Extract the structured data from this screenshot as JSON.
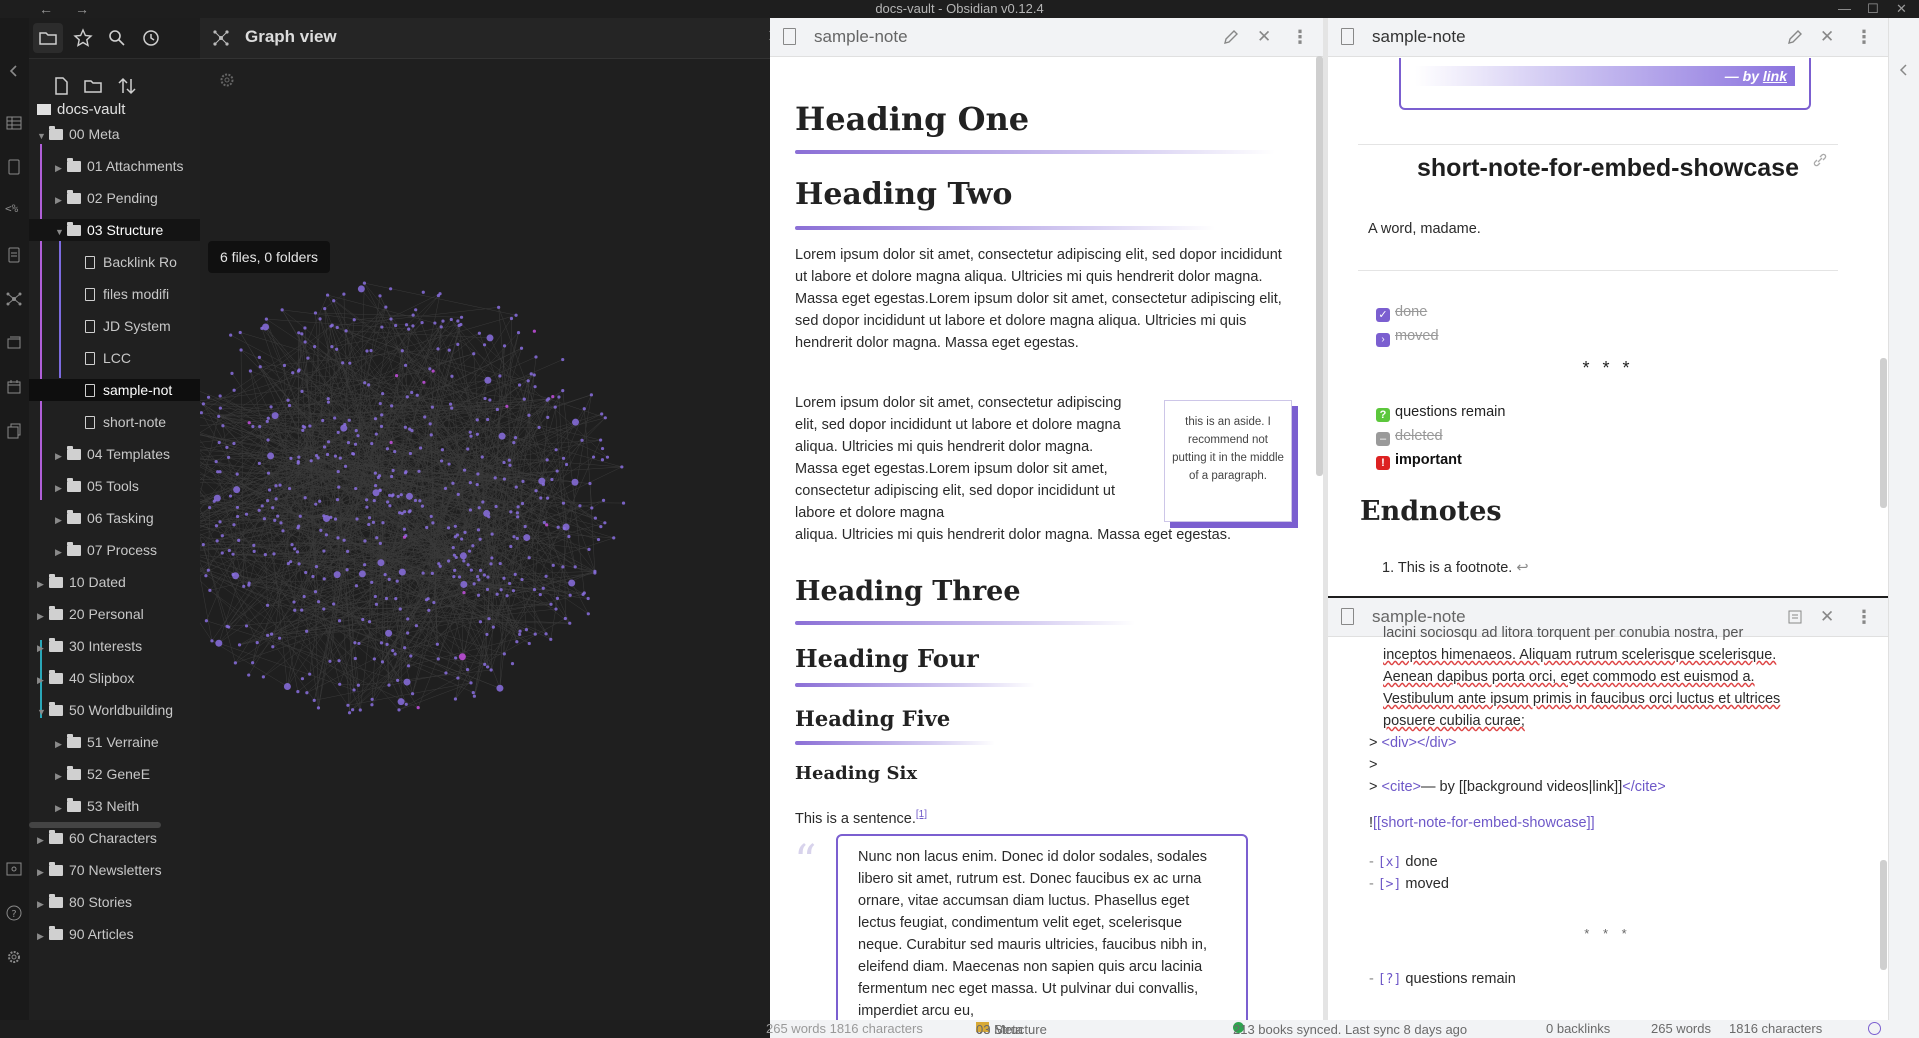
{
  "window": {
    "title": "docs-vault - Obsidian v0.12.4"
  },
  "left_sidebar": {
    "vault_name": "docs-vault",
    "tooltip": "6 files, 0 folders",
    "tree": [
      {
        "label": "00 Meta",
        "type": "folder",
        "open": true,
        "depth": 0
      },
      {
        "label": "01 Attachments",
        "type": "folder",
        "open": false,
        "depth": 1
      },
      {
        "label": "02 Pending",
        "type": "folder",
        "open": false,
        "depth": 1
      },
      {
        "label": "03 Structure",
        "type": "folder",
        "open": true,
        "depth": 1,
        "active": true
      },
      {
        "label": "Backlink Ro",
        "type": "file",
        "depth": 2
      },
      {
        "label": "files modifi",
        "type": "file",
        "depth": 2
      },
      {
        "label": "JD System",
        "type": "file",
        "depth": 2
      },
      {
        "label": "LCC",
        "type": "file",
        "depth": 2
      },
      {
        "label": "sample-not",
        "type": "file",
        "depth": 2,
        "selected": true
      },
      {
        "label": "short-note",
        "type": "file",
        "depth": 2
      },
      {
        "label": "04 Templates",
        "type": "folder",
        "open": false,
        "depth": 1
      },
      {
        "label": "05 Tools",
        "type": "folder",
        "open": false,
        "depth": 1
      },
      {
        "label": "06 Tasking",
        "type": "folder",
        "open": false,
        "depth": 1
      },
      {
        "label": "07 Process",
        "type": "folder",
        "open": false,
        "depth": 1
      },
      {
        "label": "10 Dated",
        "type": "folder",
        "open": false,
        "depth": 0
      },
      {
        "label": "20 Personal",
        "type": "folder",
        "open": false,
        "depth": 0
      },
      {
        "label": "30 Interests",
        "type": "folder",
        "open": false,
        "depth": 0
      },
      {
        "label": "40 Slipbox",
        "type": "folder",
        "open": false,
        "depth": 0
      },
      {
        "label": "50 Worldbuilding",
        "type": "folder",
        "open": true,
        "depth": 0
      },
      {
        "label": "51 Verraine",
        "type": "folder",
        "open": false,
        "depth": 1
      },
      {
        "label": "52 GeneE",
        "type": "folder",
        "open": false,
        "depth": 1
      },
      {
        "label": "53 Neith",
        "type": "folder",
        "open": false,
        "depth": 1
      },
      {
        "label": "60 Characters",
        "type": "folder",
        "open": false,
        "depth": 0
      },
      {
        "label": "70 Newsletters",
        "type": "folder",
        "open": false,
        "depth": 0
      },
      {
        "label": "80 Stories",
        "type": "folder",
        "open": false,
        "depth": 0
      },
      {
        "label": "90 Articles",
        "type": "folder",
        "open": false,
        "depth": 0
      }
    ]
  },
  "graph": {
    "title": "Graph view"
  },
  "pane_preview": {
    "title": "sample-note",
    "h1": "Heading One",
    "h2": "Heading Two",
    "p1": "Lorem ipsum dolor sit amet, consectetur adipiscing elit, sed dopor incididunt ut labore et dolore magna aliqua. Ultricies mi quis hendrerit dolor magna. Massa eget egestas.Lorem ipsum dolor sit amet, consectetur adipiscing elit, sed dopor incididunt ut labore et dolore magna aliqua. Ultricies mi quis hendrerit dolor magna. Massa eget egestas.",
    "p2": "Lorem ipsum dolor sit amet, consectetur adipiscing elit, sed dopor incididunt ut labore et dolore magna aliqua. Ultricies mi quis hendrerit dolor magna. Massa eget egestas.Lorem ipsum dolor sit amet, consectetur adipiscing elit, sed dopor incididunt ut labore et dolore magna",
    "p2_tail": "aliqua. Ultricies mi quis hendrerit dolor magna. Massa eget egestas.",
    "aside": "this is an aside. I recommend not putting it in the middle of a paragraph.",
    "h3": "Heading Three",
    "h4": "Heading Four",
    "h5": "Heading Five",
    "h6": "Heading Six",
    "sentence": "This is a sentence.",
    "footnote_ref": "[1]",
    "quote": "Nunc non lacus enim. Donec id dolor sodales, sodales libero sit amet, rutrum est. Donec faucibus ex ac urna ornare, vitae accumsan diam luctus. Phasellus eget lectus feugiat, condimentum velit eget, scelerisque neque. Curabitur sed mauris ultricies, faucibus nibh in, eleifend diam. Maecenas non sapien quis arcu lacinia fermentum nec eget massa. Ut pulvinar dui convallis, imperdiet arcu eu,"
  },
  "pane_right_top": {
    "title": "sample-note",
    "by_link_prefix": "— by ",
    "by_link": "link",
    "embed_title": "short-note-for-embed-showcase",
    "embed_text": "A word, madame.",
    "tasks": [
      {
        "label": "done",
        "kind": "done",
        "struck": true
      },
      {
        "label": "moved",
        "kind": "moved",
        "struck": true
      }
    ],
    "separator": "* * *",
    "tasks2": [
      {
        "label": "questions remain",
        "kind": "question",
        "struck": false
      },
      {
        "label": "deleted",
        "kind": "deleted",
        "struck": true
      },
      {
        "label": "important",
        "kind": "important",
        "struck": false
      }
    ],
    "endnotes_heading": "Endnotes",
    "footnote": "1. This is a footnote."
  },
  "pane_right_bottom": {
    "title": "sample-note",
    "lines": [
      "lacini sociosqu ad litora torquent per conubia nostra, per",
      "inceptos himenaeos. Aliquam rutrum scelerisque scelerisque.",
      "Aenean dapibus porta orci, eget commodo est euismod a.",
      "Vestibulum ante ipsum primis in faucibus orci luctus et ultrices",
      "posuere cubilia curae;"
    ],
    "div_line_prefix": "> ",
    "div_line": "<div></div>",
    "blank_quote": ">",
    "cite_open": "<cite>",
    "cite_text": "— by [[background videos|link]]",
    "cite_close": "</cite>",
    "embed_bang": "!",
    "embed_link": "[[short-note-for-embed-showcase]]",
    "task_done": "done",
    "task_moved": "moved",
    "mark_done": "[x]",
    "mark_moved": "[>]",
    "separator": "* * *",
    "mark_q": "[?]",
    "task_q": "questions remain"
  },
  "status": {
    "left_counts": "265 words 1816 characters",
    "crumb1": "00 Meta",
    "crumb_sep": "»",
    "crumb2": "03 Structure",
    "sync": "213 books synced. Last sync 8 days ago",
    "backlinks": "0 backlinks",
    "words": "265 words",
    "chars": "1816 characters"
  },
  "colors": {
    "accent": "#7b5fd0",
    "graph_node": "#8a6fe0",
    "graph_node_hot": "#c44fe0"
  }
}
